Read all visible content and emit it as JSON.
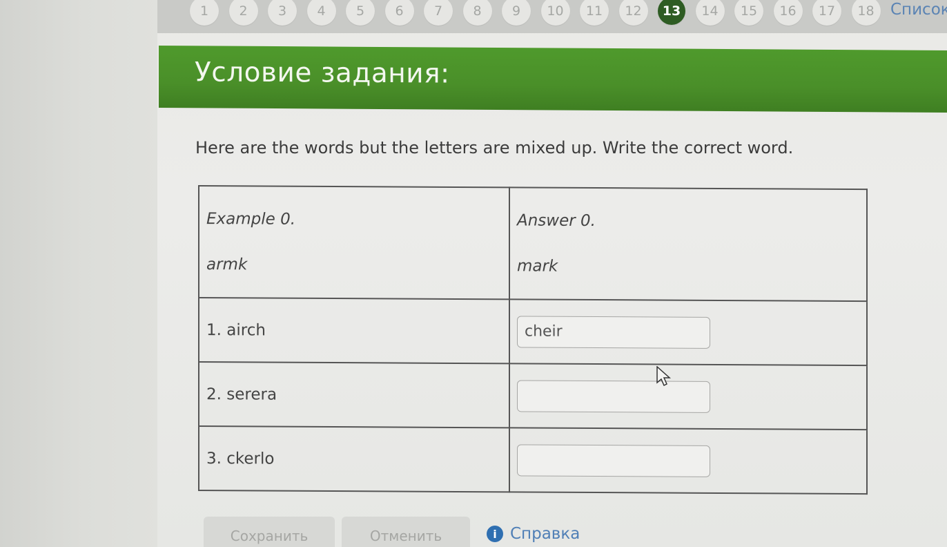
{
  "pager": {
    "pages": [
      "1",
      "2",
      "3",
      "4",
      "5",
      "6",
      "7",
      "8",
      "9",
      "10",
      "11",
      "12",
      "13",
      "14",
      "15",
      "16",
      "17",
      "18"
    ],
    "active": "13",
    "list_label": "Список"
  },
  "header": {
    "title": "Условие задания:"
  },
  "instruction": "Here are the words but the letters are mixed up. Write the correct word.",
  "table": {
    "example": {
      "label": "Example 0.",
      "word": "armk",
      "answer_label": "Answer 0.",
      "answer": "mark"
    },
    "rows": [
      {
        "question": "1. airch",
        "answer": "cheir"
      },
      {
        "question": "2. serera",
        "answer": ""
      },
      {
        "question": "3. ckerlo",
        "answer": ""
      }
    ]
  },
  "footer": {
    "save_label": "Сохранить",
    "cancel_label": "Отменить",
    "help_label": "Справка"
  },
  "colors": {
    "header_green": "#4a8f29",
    "active_page": "#2e5c23",
    "link_blue": "#5b84b4"
  }
}
